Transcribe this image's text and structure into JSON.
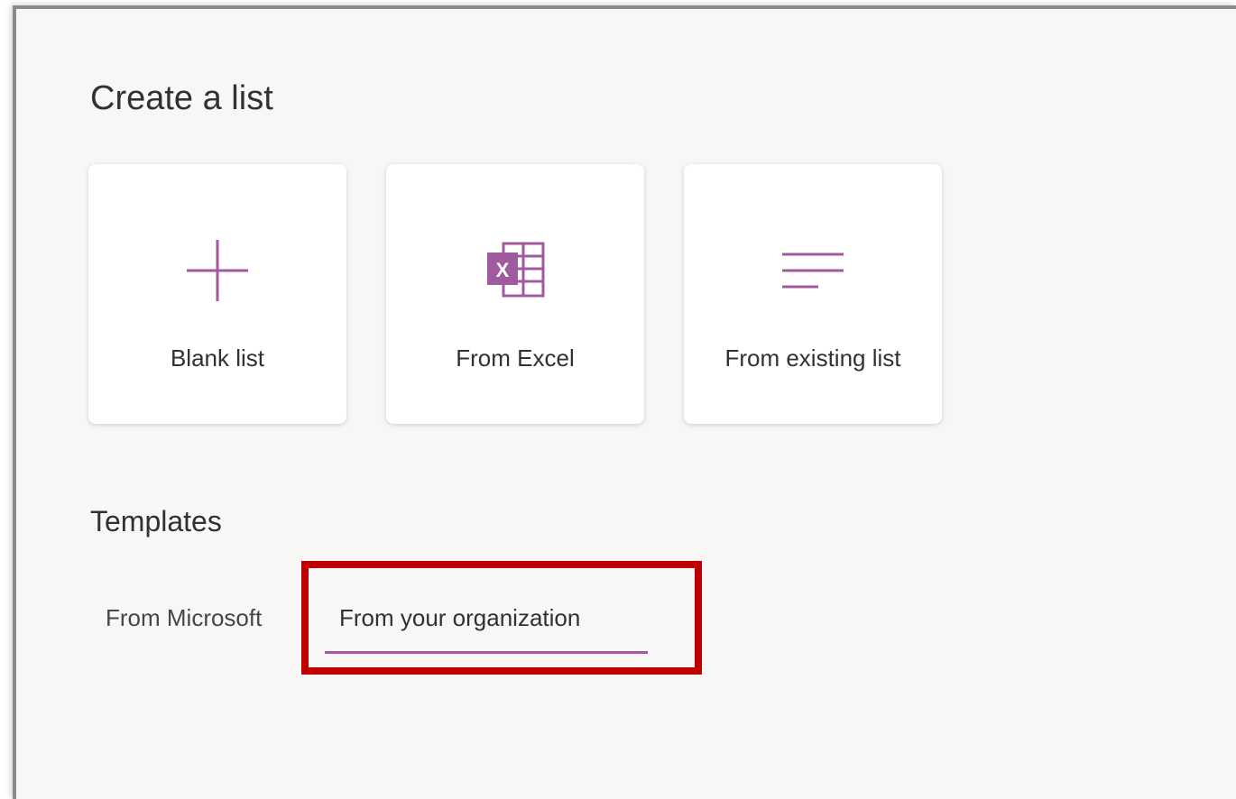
{
  "dialog": {
    "title": "Create a list"
  },
  "create_options": [
    {
      "label": "Blank list",
      "icon": "plus-icon"
    },
    {
      "label": "From Excel",
      "icon": "excel-icon"
    },
    {
      "label": "From existing list",
      "icon": "list-lines-icon"
    }
  ],
  "templates": {
    "heading": "Templates",
    "tabs": [
      {
        "label": "From Microsoft",
        "selected": false
      },
      {
        "label": "From your organization",
        "selected": true
      }
    ]
  },
  "colors": {
    "accent": "#a05b9e",
    "highlight_border": "#c00000",
    "panel_background": "#f8f7f6"
  }
}
